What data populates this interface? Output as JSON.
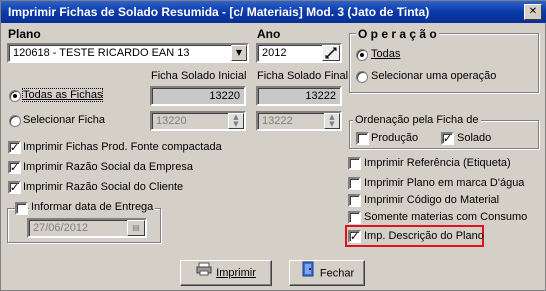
{
  "window": {
    "title": "Imprimir Fichas de Solado Resumida - [c/ Materiais] Mod. 3 (Jato de Tinta)",
    "close_glyph": "✕"
  },
  "plano": {
    "label": "Plano",
    "value": "120618 - TESTE RICARDO EAN 13"
  },
  "ano": {
    "label": "Ano",
    "value": "2012"
  },
  "operacao": {
    "title": "O p e r a ç ã o",
    "options": [
      {
        "label": "Todas",
        "selected": true
      },
      {
        "label": "Selecionar uma operação",
        "selected": false
      }
    ]
  },
  "fichas": {
    "header_initial": "Ficha Solado Inicial",
    "header_final": "Ficha Solado Final",
    "todas_label": "Todas as Fichas",
    "todas_initial": "13220",
    "todas_final": "13222",
    "selecionar_label": "Selecionar Ficha",
    "sel_initial": "13220",
    "sel_final": "13222"
  },
  "ordenacao": {
    "title": "Ordenação pela Ficha de",
    "producao": {
      "label": "Produção",
      "checked": false
    },
    "solado": {
      "label": "Solado",
      "checked": true
    }
  },
  "left_options": [
    {
      "label": "Imprimir Fichas Prod. Fonte compactada",
      "checked": true
    },
    {
      "label": "Imprimir Razão Social da Empresa",
      "checked": true
    },
    {
      "label": "Imprimir Razão Social do Cliente",
      "checked": true
    }
  ],
  "entrega": {
    "label": "Informar data de  Entrega",
    "checked": false,
    "date": "27/06/2012"
  },
  "right_options": [
    {
      "label": "Imprimir Referência (Etiqueta)",
      "checked": false
    },
    {
      "label": "Imprimir Plano em marca D'água",
      "checked": false
    },
    {
      "label": "Imprimir Código do Material",
      "checked": false
    },
    {
      "label": "Somente materias com Consumo",
      "checked": false
    },
    {
      "label": "Imp. Descrição do Plano",
      "checked": true
    }
  ],
  "buttons": {
    "imprimir": "Imprimir",
    "fechar": "Fechar"
  },
  "colors": {
    "title_bar": "#0a3aa8",
    "highlight": "#e0141e",
    "face": "#d4d0c8"
  }
}
